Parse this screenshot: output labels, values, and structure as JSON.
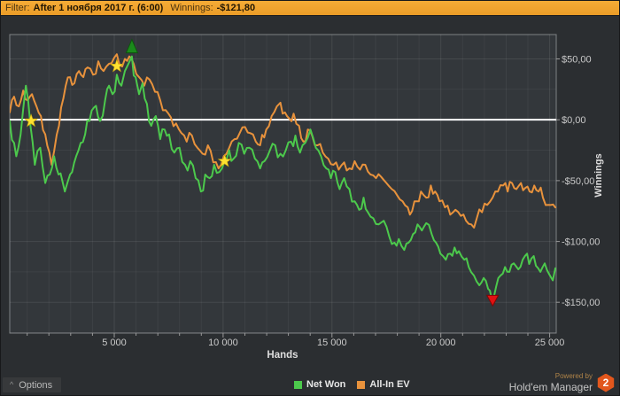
{
  "header": {
    "filter_label": "Filter:",
    "filter_value": "After 1 ноября 2017 г. (6:00)",
    "winnings_label": "Winnings:",
    "winnings_value": "-$121,80"
  },
  "options_button": {
    "label": "Options",
    "caret": "^"
  },
  "legend": [
    {
      "label": "Net Won",
      "color": "#4cc94c"
    },
    {
      "label": "All-In EV",
      "color": "#e8923c"
    }
  ],
  "powered_by": {
    "line1": "Powered by",
    "line2": "Hold'em Manager",
    "badge": "2"
  },
  "colors": {
    "accent_bar": "#efa233",
    "net_won": "#4cc94c",
    "all_in_ev": "#e8923c",
    "zero_line": "#ffffff",
    "star": "#ffe131",
    "arrow_up": "#1b8a1b",
    "arrow_down": "#e01212",
    "plot_bg": "#33373b",
    "plot_border": "#7e8184",
    "grid": "rgba(255,255,255,0.055)",
    "axis_text": "#c9c9c9"
  },
  "chart_data": {
    "type": "line",
    "xlabel": "Hands",
    "ylabel": "Winnings",
    "xlim": [
      200,
      25300
    ],
    "ylim": [
      -175.3,
      70
    ],
    "x_ticks": [
      5000,
      10000,
      15000,
      20000,
      25000
    ],
    "x_tick_labels": [
      "5 000",
      "10 000",
      "15 000",
      "20 000",
      "25 000"
    ],
    "x_minor_step": 1000,
    "y_ticks": [
      50,
      0,
      -50,
      -100,
      -150
    ],
    "y_tick_labels": [
      "$50,00",
      "$0,00",
      "-$50,00",
      "-$100,00",
      "-$150,00"
    ],
    "y_minor_step": 25,
    "zero_line": 0,
    "legend_position": "bottom",
    "grid": true,
    "series": [
      {
        "name": "All-In EV",
        "color": "#e8923c",
        "points": [
          [
            200,
            6
          ],
          [
            400,
            19
          ],
          [
            620,
            11
          ],
          [
            820,
            24
          ],
          [
            1020,
            16
          ],
          [
            1220,
            21
          ],
          [
            1430,
            11
          ],
          [
            1630,
            3
          ],
          [
            1830,
            -12
          ],
          [
            2120,
            -37
          ],
          [
            2360,
            -12
          ],
          [
            2560,
            10
          ],
          [
            2770,
            28
          ],
          [
            2970,
            35
          ],
          [
            3170,
            30
          ],
          [
            3380,
            40
          ],
          [
            3580,
            35
          ],
          [
            3780,
            43
          ],
          [
            4030,
            37
          ],
          [
            4270,
            48
          ],
          [
            4510,
            40
          ],
          [
            4760,
            46
          ],
          [
            5000,
            51
          ],
          [
            5240,
            45
          ],
          [
            5490,
            50
          ],
          [
            5690,
            52
          ],
          [
            5890,
            46
          ],
          [
            6140,
            35
          ],
          [
            6380,
            28
          ],
          [
            6620,
            33
          ],
          [
            6870,
            23
          ],
          [
            7110,
            16
          ],
          [
            7360,
            8
          ],
          [
            7600,
            2
          ],
          [
            7840,
            -3
          ],
          [
            8090,
            -11
          ],
          [
            8330,
            -18
          ],
          [
            8570,
            -13
          ],
          [
            8820,
            -23
          ],
          [
            9060,
            -28
          ],
          [
            9300,
            -21
          ],
          [
            9550,
            -35
          ],
          [
            9790,
            -40
          ],
          [
            10030,
            -30
          ],
          [
            10280,
            -23
          ],
          [
            10520,
            -16
          ],
          [
            10760,
            -11
          ],
          [
            11010,
            -6
          ],
          [
            11250,
            -11
          ],
          [
            11500,
            -18
          ],
          [
            11700,
            -21
          ],
          [
            11980,
            -8
          ],
          [
            12230,
            3
          ],
          [
            12470,
            11
          ],
          [
            12630,
            14
          ],
          [
            12840,
            6
          ],
          [
            13040,
            1
          ],
          [
            13240,
            5
          ],
          [
            13490,
            -5
          ],
          [
            13690,
            -18
          ],
          [
            13890,
            -8
          ],
          [
            14090,
            -13
          ],
          [
            14340,
            -21
          ],
          [
            14580,
            -27
          ],
          [
            14830,
            -32
          ],
          [
            15070,
            -37
          ],
          [
            15310,
            -41
          ],
          [
            15560,
            -35
          ],
          [
            15800,
            -40
          ],
          [
            16040,
            -34
          ],
          [
            16290,
            -41
          ],
          [
            16530,
            -37
          ],
          [
            16770,
            -45
          ],
          [
            17020,
            -48
          ],
          [
            17260,
            -47
          ],
          [
            17500,
            -52
          ],
          [
            17750,
            -57
          ],
          [
            17990,
            -62
          ],
          [
            18240,
            -67
          ],
          [
            18480,
            -72
          ],
          [
            18680,
            -75
          ],
          [
            18890,
            -67
          ],
          [
            19090,
            -59
          ],
          [
            19330,
            -64
          ],
          [
            19540,
            -54
          ],
          [
            19740,
            -59
          ],
          [
            19940,
            -67
          ],
          [
            20190,
            -72
          ],
          [
            20430,
            -78
          ],
          [
            20670,
            -74
          ],
          [
            20920,
            -79
          ],
          [
            21160,
            -83
          ],
          [
            21400,
            -86
          ],
          [
            21650,
            -81
          ],
          [
            21890,
            -76
          ],
          [
            22130,
            -70
          ],
          [
            22380,
            -64
          ],
          [
            22620,
            -59
          ],
          [
            22860,
            -54
          ],
          [
            23070,
            -59
          ],
          [
            23270,
            -52
          ],
          [
            23470,
            -57
          ],
          [
            23680,
            -52
          ],
          [
            23880,
            -56
          ],
          [
            24080,
            -59
          ],
          [
            24290,
            -54
          ],
          [
            24490,
            -59
          ],
          [
            24690,
            -64
          ],
          [
            24940,
            -70
          ],
          [
            25260,
            -72
          ]
        ]
      },
      {
        "name": "Net Won",
        "color": "#4cc94c",
        "points": [
          [
            200,
            -1
          ],
          [
            400,
            -19
          ],
          [
            500,
            -30
          ],
          [
            700,
            -12
          ],
          [
            940,
            28
          ],
          [
            1150,
            -5
          ],
          [
            1350,
            -37
          ],
          [
            1600,
            -23
          ],
          [
            1830,
            -52
          ],
          [
            2040,
            -45
          ],
          [
            2240,
            -30
          ],
          [
            2440,
            -45
          ],
          [
            2730,
            -59
          ],
          [
            2970,
            -45
          ],
          [
            3250,
            -30
          ],
          [
            3460,
            -19
          ],
          [
            3660,
            -12
          ],
          [
            3860,
            -1
          ],
          [
            4070,
            10
          ],
          [
            4350,
            -1
          ],
          [
            4590,
            17
          ],
          [
            4760,
            28
          ],
          [
            4920,
            21
          ],
          [
            5120,
            37
          ],
          [
            5330,
            28
          ],
          [
            5490,
            40
          ],
          [
            5650,
            46
          ],
          [
            5810,
            52
          ],
          [
            5980,
            35
          ],
          [
            6140,
            21
          ],
          [
            6300,
            30
          ],
          [
            6500,
            13
          ],
          [
            6700,
            -5
          ],
          [
            6910,
            3
          ],
          [
            7110,
            -16
          ],
          [
            7310,
            -8
          ],
          [
            7520,
            -12
          ],
          [
            7760,
            -27
          ],
          [
            8000,
            -23
          ],
          [
            8250,
            -37
          ],
          [
            8490,
            -34
          ],
          [
            8740,
            -48
          ],
          [
            8980,
            -59
          ],
          [
            9180,
            -45
          ],
          [
            9380,
            -48
          ],
          [
            9590,
            -37
          ],
          [
            9830,
            -43
          ],
          [
            10070,
            -34
          ],
          [
            10280,
            -25
          ],
          [
            10480,
            -32
          ],
          [
            10720,
            -19
          ],
          [
            10970,
            -28
          ],
          [
            11210,
            -23
          ],
          [
            11460,
            -32
          ],
          [
            11700,
            -40
          ],
          [
            11900,
            -34
          ],
          [
            12150,
            -25
          ],
          [
            12390,
            -21
          ],
          [
            12630,
            -28
          ],
          [
            12880,
            -25
          ],
          [
            13120,
            -18
          ],
          [
            13320,
            -13
          ],
          [
            13530,
            -27
          ],
          [
            13770,
            -19
          ],
          [
            14010,
            -8
          ],
          [
            14260,
            -23
          ],
          [
            14500,
            -30
          ],
          [
            14740,
            -40
          ],
          [
            14950,
            -48
          ],
          [
            15150,
            -43
          ],
          [
            15350,
            -57
          ],
          [
            15560,
            -48
          ],
          [
            15800,
            -57
          ],
          [
            16040,
            -67
          ],
          [
            16250,
            -74
          ],
          [
            16450,
            -64
          ],
          [
            16650,
            -76
          ],
          [
            16900,
            -81
          ],
          [
            17140,
            -86
          ],
          [
            17380,
            -83
          ],
          [
            17630,
            -96
          ],
          [
            17870,
            -101
          ],
          [
            18070,
            -98
          ],
          [
            18320,
            -107
          ],
          [
            18520,
            -101
          ],
          [
            18720,
            -94
          ],
          [
            18930,
            -86
          ],
          [
            19130,
            -91
          ],
          [
            19330,
            -85
          ],
          [
            19580,
            -94
          ],
          [
            19780,
            -101
          ],
          [
            19980,
            -110
          ],
          [
            20230,
            -115
          ],
          [
            20430,
            -110
          ],
          [
            20630,
            -105
          ],
          [
            20830,
            -108
          ],
          [
            21080,
            -115
          ],
          [
            21280,
            -121
          ],
          [
            21520,
            -128
          ],
          [
            21770,
            -136
          ],
          [
            21970,
            -130
          ],
          [
            22170,
            -139
          ],
          [
            22340,
            -147
          ],
          [
            22540,
            -137
          ],
          [
            22740,
            -128
          ],
          [
            22950,
            -121
          ],
          [
            23150,
            -125
          ],
          [
            23350,
            -118
          ],
          [
            23560,
            -123
          ],
          [
            23760,
            -115
          ],
          [
            23960,
            -110
          ],
          [
            24160,
            -114
          ],
          [
            24370,
            -120
          ],
          [
            24570,
            -125
          ],
          [
            24770,
            -118
          ],
          [
            24980,
            -127
          ],
          [
            25140,
            -132
          ],
          [
            25260,
            -122
          ]
        ]
      }
    ],
    "markers": [
      {
        "shape": "star",
        "hands": 1180,
        "value": -1
      },
      {
        "shape": "star",
        "hands": 5120,
        "value": 44
      },
      {
        "shape": "star",
        "hands": 10070,
        "value": -34
      },
      {
        "shape": "arrow-up",
        "hands": 5810,
        "value": 55
      },
      {
        "shape": "arrow-down",
        "hands": 22380,
        "value": -153
      }
    ]
  }
}
